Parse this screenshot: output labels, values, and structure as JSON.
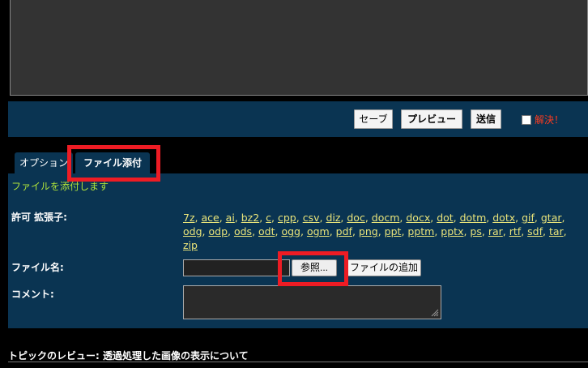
{
  "toolbar": {
    "save_label": "セーブ",
    "preview_label": "プレビュー",
    "submit_label": "送信",
    "solved_label": "解決！"
  },
  "tabs": [
    {
      "label": "オプション",
      "active": false
    },
    {
      "label": "ファイル添付",
      "active": true
    }
  ],
  "attach": {
    "description": "ファイルを添付します",
    "allowed_label": "許可 拡張子:",
    "extension_lines": [
      [
        "7z",
        "ace",
        "ai",
        "bz2",
        "c",
        "cpp",
        "csv",
        "diz",
        "doc",
        "docm",
        "docx",
        "dot",
        "dotm",
        "dotx",
        "gif",
        "gtar"
      ],
      [
        "odg",
        "odp",
        "ods",
        "odt",
        "ogg",
        "ogm",
        "pdf",
        "png",
        "ppt",
        "pptm",
        "pptx",
        "ps",
        "rar",
        "rtf",
        "sdf",
        "tar"
      ],
      [
        "zip"
      ]
    ],
    "filename_label": "ファイル名:",
    "browse_label": "参照...",
    "add_file_label": "ファイルの追加",
    "comment_label": "コメント:"
  },
  "review": {
    "title": "トピックのレビュー: 透過処理した画像の表示について"
  },
  "colors": {
    "panel_bg": "#0a3452",
    "page_bg": "#000000",
    "link_yellow": "#e8e37a",
    "desc_green": "#aee23b",
    "solved_red": "#ff3b1f",
    "highlight_red": "#ee1c24"
  }
}
